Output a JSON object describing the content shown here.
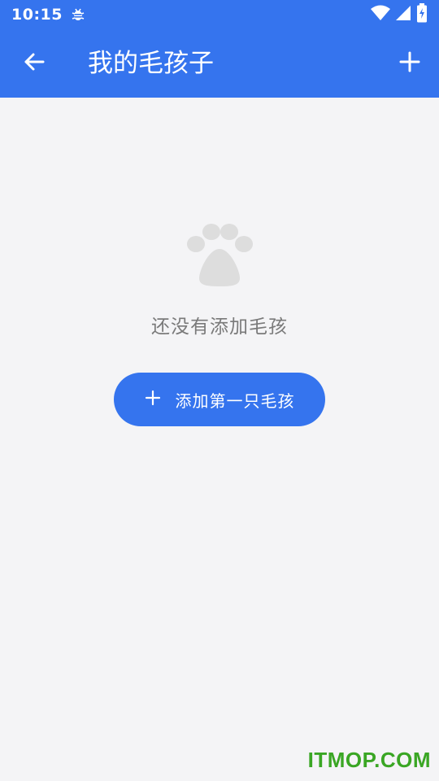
{
  "status_bar": {
    "time": "10:15",
    "icons": [
      "bug-icon",
      "wifi-icon",
      "signal-icon",
      "battery-charging-icon"
    ]
  },
  "app_bar": {
    "title": "我的毛孩子",
    "back_icon": "arrow-left-icon",
    "add_icon": "plus-icon"
  },
  "empty_state": {
    "icon": "paw-icon",
    "message": "还没有添加毛孩",
    "button_label": "添加第一只毛孩",
    "button_icon": "plus-icon"
  },
  "watermark": "ITMOP.COM",
  "colors": {
    "primary": "#3574ee",
    "background": "#f4f4f6",
    "muted_text": "#7a7a7a",
    "paw": "#dddddd",
    "watermark": "#3aa624"
  }
}
